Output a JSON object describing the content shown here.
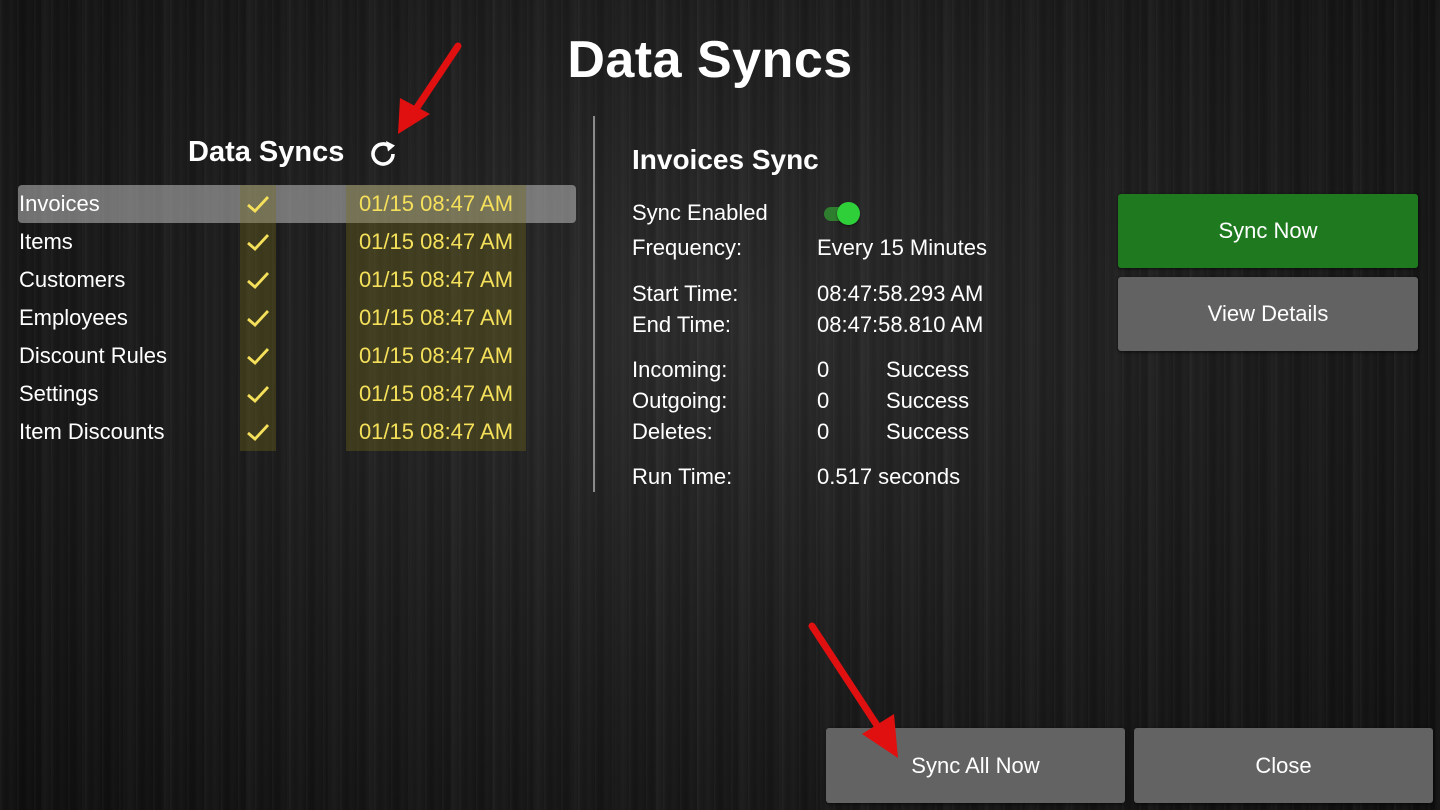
{
  "page": {
    "title": "Data Syncs"
  },
  "sync_list": {
    "title": "Data Syncs",
    "refresh_icon": "refresh-icon",
    "items": [
      {
        "name": "Invoices",
        "status_icon": "checkmark-icon",
        "last_sync": "01/15 08:47 AM",
        "selected": true
      },
      {
        "name": "Items",
        "status_icon": "checkmark-icon",
        "last_sync": "01/15 08:47 AM"
      },
      {
        "name": "Customers",
        "status_icon": "checkmark-icon",
        "last_sync": "01/15 08:47 AM"
      },
      {
        "name": "Employees",
        "status_icon": "checkmark-icon",
        "last_sync": "01/15 08:47 AM"
      },
      {
        "name": "Discount Rules",
        "status_icon": "checkmark-icon",
        "last_sync": "01/15 08:47 AM"
      },
      {
        "name": "Settings",
        "status_icon": "checkmark-icon",
        "last_sync": "01/15 08:47 AM"
      },
      {
        "name": "Item Discounts",
        "status_icon": "checkmark-icon",
        "last_sync": "01/15 08:47 AM"
      }
    ]
  },
  "detail": {
    "title": "Invoices Sync",
    "sync_enabled_label": "Sync Enabled",
    "sync_enabled": true,
    "frequency_label": "Frequency:",
    "frequency_value": "Every 15 Minutes",
    "start_time_label": "Start Time:",
    "start_time_value": "08:47:58.293 AM",
    "end_time_label": "End Time:",
    "end_time_value": "08:47:58.810 AM",
    "incoming_label": "Incoming:",
    "incoming_value": "0",
    "incoming_status": "Success",
    "outgoing_label": "Outgoing:",
    "outgoing_value": "0",
    "outgoing_status": "Success",
    "deletes_label": "Deletes:",
    "deletes_value": "0",
    "deletes_status": "Success",
    "run_time_label": "Run Time:",
    "run_time_value": "0.517 seconds"
  },
  "buttons": {
    "sync_now": "Sync Now",
    "view_details": "View Details",
    "sync_all_now": "Sync All Now",
    "close": "Close"
  },
  "colors": {
    "sync_now_bg": "#1f7a1f",
    "gray_button_bg": "#636363",
    "timestamp_text": "#f4e05a",
    "checkmark": "#f4e05a",
    "toggle_on": "#2fcf3a",
    "annotation_arrow": "#e01010"
  }
}
